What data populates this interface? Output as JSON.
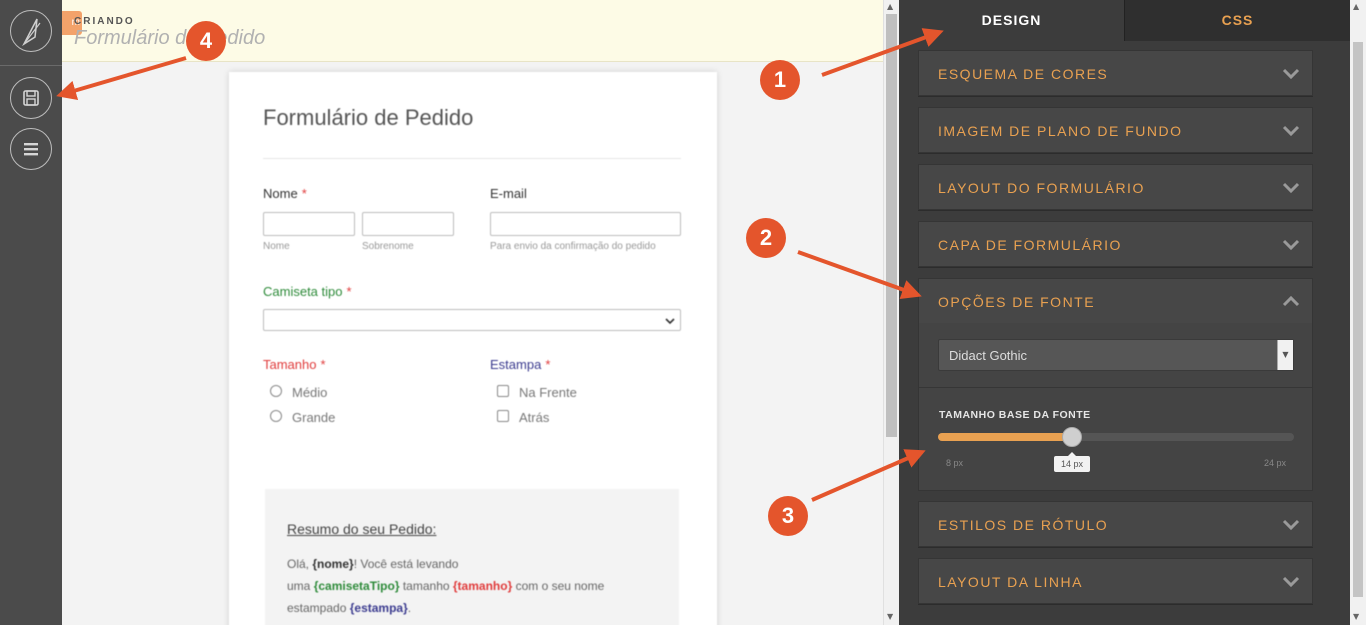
{
  "editor": {
    "header_tag": "m",
    "header_label": "CRIANDO",
    "form_name": "Formulário de Pedido"
  },
  "form": {
    "title": "Formulário de  Pedido",
    "name_label": "Nome",
    "required_mark": "*",
    "name_first_sub": "Nome",
    "name_last_sub": "Sobrenome",
    "email_label": "E-mail",
    "email_sub": "Para envio da confirmação do pedido",
    "shirt_label": "Camiseta tipo",
    "size_label": "Tamanho",
    "size_options": [
      "Médio",
      "Grande"
    ],
    "print_label": "Estampa",
    "print_options": [
      "Na  Frente",
      "Atrás"
    ],
    "summary": {
      "title": "Resumo do seu  Pedido:",
      "line1_prefix": "Olá, ",
      "token_name": "{nome}",
      "line1_suffix": "! Você está levando",
      "line2_prefix": "uma ",
      "token_shirt": "{camisetaTipo}",
      "line2_mid": " tamanho ",
      "token_size": "{tamanho}",
      "line2_suffix": " com o seu nome",
      "line3_prefix": "estampado ",
      "token_print": "{estampa}",
      "line3_suffix": "."
    }
  },
  "panel": {
    "tabs": [
      "DESIGN",
      "CSS"
    ],
    "sections": [
      "ESQUEMA DE CORES",
      "IMAGEM DE PLANO DE FUNDO",
      "LAYOUT DO FORMULÁRIO",
      "CAPA DE FORMULÁRIO",
      "OPÇÕES DE FONTE",
      "ESTILOS DE RÓTULO",
      "LAYOUT DA LINHA"
    ],
    "font_family": "Didact Gothic",
    "font_size_label": "TAMANHO BASE DA FONTE",
    "font_size_min": "8 px",
    "font_size_max": "24 px",
    "font_size_value": "14 px",
    "font_size_fraction": 0.375
  },
  "annotations": [
    "1",
    "2",
    "3",
    "4"
  ],
  "colors": {
    "accent_orange": "#e9a151",
    "annotation": "#e4552c",
    "panel_bg": "#3c3c3c",
    "sidebar_bg": "#4b4b4b",
    "shirt_label": "#2e8b3a",
    "size_label": "#e03b3b",
    "print_label": "#3b3b8f"
  }
}
